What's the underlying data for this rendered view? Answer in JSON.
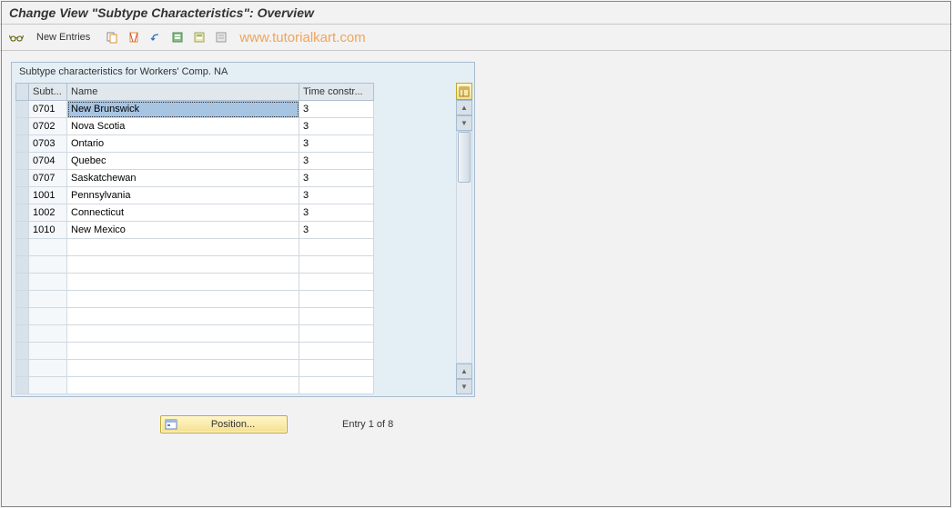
{
  "header": {
    "title": "Change View \"Subtype Characteristics\": Overview"
  },
  "toolbar": {
    "new_entries_label": "New Entries",
    "watermark": "www.tutorialkart.com"
  },
  "panel": {
    "title": "Subtype characteristics for Workers' Comp.  NA",
    "columns": {
      "subt": "Subt...",
      "name": "Name",
      "time": "Time constr..."
    },
    "rows": [
      {
        "subt": "0701",
        "name": "New Brunswick",
        "time": "3",
        "selected_name": true
      },
      {
        "subt": "0702",
        "name": "Nova Scotia",
        "time": "3"
      },
      {
        "subt": "0703",
        "name": "Ontario",
        "time": "3"
      },
      {
        "subt": "0704",
        "name": "Quebec",
        "time": "3"
      },
      {
        "subt": "0707",
        "name": "Saskatchewan",
        "time": "3"
      },
      {
        "subt": "1001",
        "name": "Pennsylvania",
        "time": "3"
      },
      {
        "subt": "1002",
        "name": "Connecticut",
        "time": "3"
      },
      {
        "subt": "1010",
        "name": "New Mexico",
        "time": "3"
      }
    ],
    "empty_rows": 9
  },
  "footer": {
    "position_label": "Position...",
    "entry_text": "Entry 1 of 8"
  }
}
